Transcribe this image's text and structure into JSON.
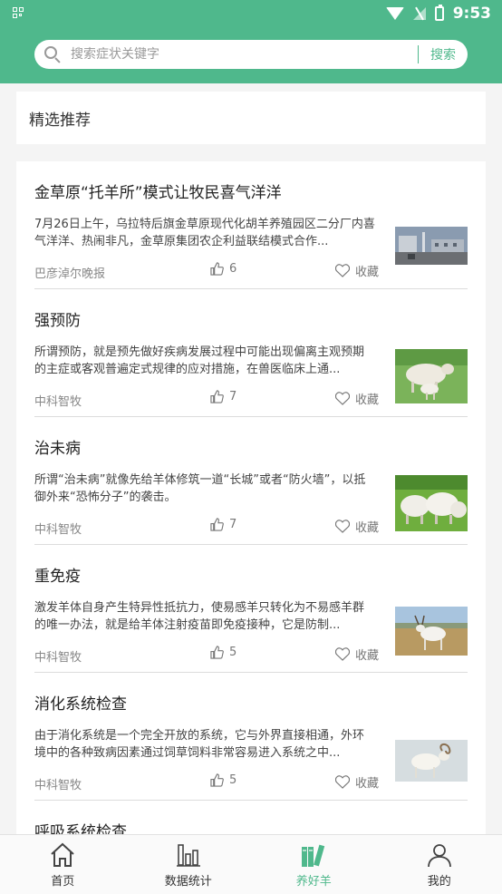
{
  "status_bar": {
    "time": "9:53"
  },
  "search": {
    "placeholder": "搜索症状关键字",
    "button_label": "搜索"
  },
  "section": {
    "title": "精选推荐"
  },
  "articles": [
    {
      "title": "金草原“托羊所”模式让牧民喜气洋洋",
      "desc": "7月26日上午，乌拉特后旗金草原现代化胡羊养殖园区二分厂内喜气洋洋、热闹非凡，金草原集团农企利益联结模式合作...",
      "source": "巴彦淖尔晚报",
      "likes": "6",
      "fav_label": "收藏"
    },
    {
      "title": "强预防",
      "desc": "所谓预防，就是预先做好疾病发展过程中可能出现偏离主观预期的主症或客观普遍定式规律的应对措施，在兽医临床上通...",
      "source": "中科智牧",
      "likes": "7",
      "fav_label": "收藏"
    },
    {
      "title": "治未病",
      "desc": "所谓“治未病”就像先给羊体修筑一道“长城”或者“防火墙”，以抵御外来“恐怖分子”的袭击。",
      "source": "中科智牧",
      "likes": "7",
      "fav_label": "收藏"
    },
    {
      "title": "重免疫",
      "desc": "激发羊体自身产生特异性抵抗力，使易感羊只转化为不易感羊群的唯一办法，就是给羊体注射疫苗即免疫接种，它是防制...",
      "source": "中科智牧",
      "likes": "5",
      "fav_label": "收藏"
    },
    {
      "title": "消化系统检查",
      "desc": "由于消化系统是一个完全开放的系统，它与外界直接相通，外环境中的各种致病因素通过饲草饲料非常容易进入系统之中...",
      "source": "中科智牧",
      "likes": "5",
      "fav_label": "收藏"
    },
    {
      "title": "呼吸系统检查",
      "desc": "",
      "source": "",
      "likes": "",
      "fav_label": ""
    }
  ],
  "bottom_nav": [
    {
      "label": "首页",
      "icon": "home-icon"
    },
    {
      "label": "数据统计",
      "icon": "bar-chart-icon"
    },
    {
      "label": "养好羊",
      "icon": "books-icon",
      "active": true
    },
    {
      "label": "我的",
      "icon": "user-icon"
    }
  ],
  "colors": {
    "accent": "#4fb88c"
  }
}
